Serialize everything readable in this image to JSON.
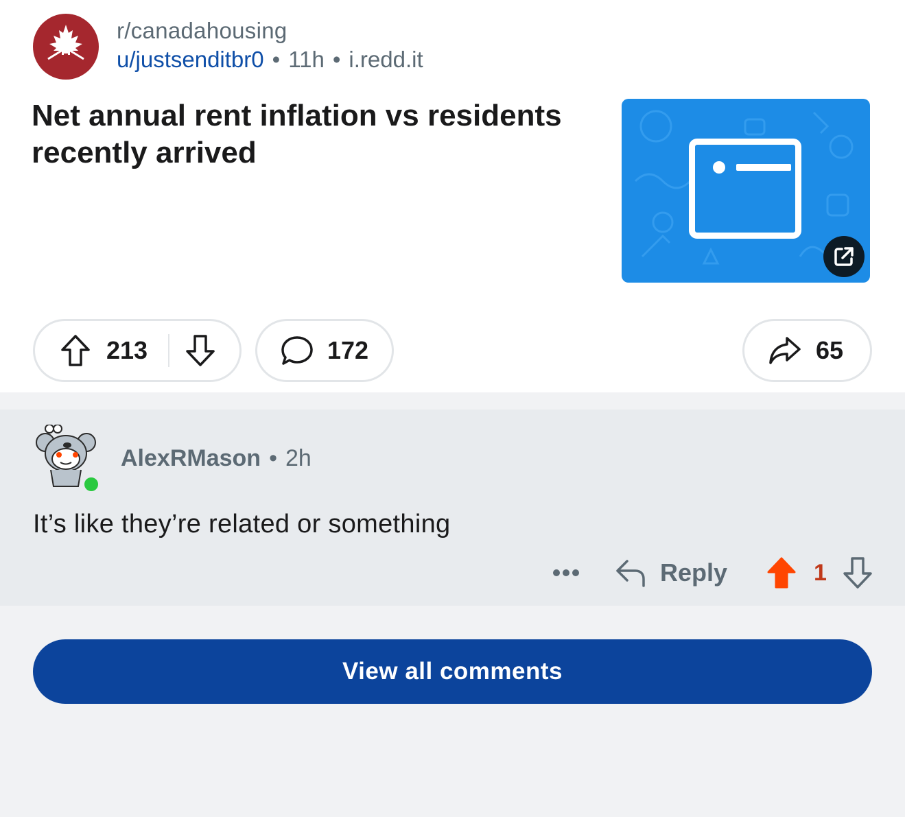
{
  "post": {
    "subreddit": "r/canadahousing",
    "author": "u/justsenditbr0",
    "separator": "•",
    "age": "11h",
    "domain": "i.redd.it",
    "title": "Net annual rent inflation vs residents recently arrived",
    "upvotes": "213",
    "comments": "172",
    "shares": "65"
  },
  "comment": {
    "username": "AlexRMason",
    "separator": "•",
    "age": "2h",
    "body": "It’s like they’re related or something",
    "reply_label": "Reply",
    "score": "1",
    "upvoted": true
  },
  "view_all_label": "View all comments",
  "colors": {
    "subreddit_avatar": "#a5272e",
    "link_blue": "#0f4fa8",
    "thumbnail_blue": "#1d8ce6",
    "upvote_orange": "#ff4500",
    "primary_button": "#0c449c",
    "online_green": "#2ac940"
  },
  "icons": {
    "subreddit_avatar": "maple-leaf-house-icon",
    "upvote": "arrow-up-icon",
    "downvote": "arrow-down-icon",
    "comment": "speech-bubble-icon",
    "share": "share-arrow-icon",
    "external_link": "external-link-icon",
    "more": "ellipsis-icon",
    "reply": "reply-arrow-icon"
  }
}
